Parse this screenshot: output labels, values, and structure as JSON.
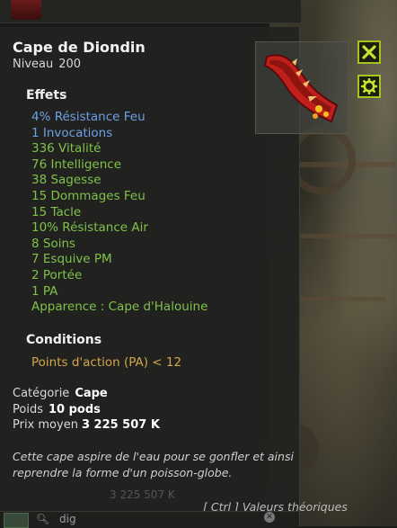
{
  "item": {
    "name": "Cape de Diondin",
    "level_label": "Niveau",
    "level": "200"
  },
  "effects_title": "Effets",
  "effects": [
    {
      "text": "4% Résistance Feu",
      "color": "blue"
    },
    {
      "text": "1 Invocations",
      "color": "blue"
    },
    {
      "text": "336 Vitalité",
      "color": "green"
    },
    {
      "text": "76 Intelligence",
      "color": "green"
    },
    {
      "text": "38 Sagesse",
      "color": "green"
    },
    {
      "text": "15 Dommages Feu",
      "color": "green"
    },
    {
      "text": "15 Tacle",
      "color": "green"
    },
    {
      "text": "10% Résistance Air",
      "color": "green"
    },
    {
      "text": "8 Soins",
      "color": "green"
    },
    {
      "text": "7 Esquive PM",
      "color": "green"
    },
    {
      "text": "2 Portée",
      "color": "green"
    },
    {
      "text": "1 PA",
      "color": "green"
    },
    {
      "text": "Apparence : Cape d'Halouine",
      "color": "green"
    }
  ],
  "conditions_title": "Conditions",
  "conditions": [
    "Points d'action (PA) < 12"
  ],
  "details": {
    "category_label": "Catégorie",
    "category": "Cape",
    "weight_label": "Poids",
    "weight": "10 pods",
    "price_label": "Prix moyen",
    "price": "3 225 507 K"
  },
  "description": "Cette cape aspire de l'eau pour se gonfler et ainsi reprendre la forme d'un poisson-globe.",
  "ghost_price": "3 225 507 K",
  "footer_hint": "[ Ctrl ] Valeurs théoriques",
  "search": {
    "value": "dig"
  },
  "icons": {
    "close": "close-icon",
    "settings": "gear-icon",
    "item": "cape-item-icon",
    "search": "search-icon"
  },
  "colors": {
    "effect_blue": "#6ea0e6",
    "effect_green": "#7fc24a",
    "condition": "#d4a64a",
    "button_border": "#a8c21e"
  }
}
